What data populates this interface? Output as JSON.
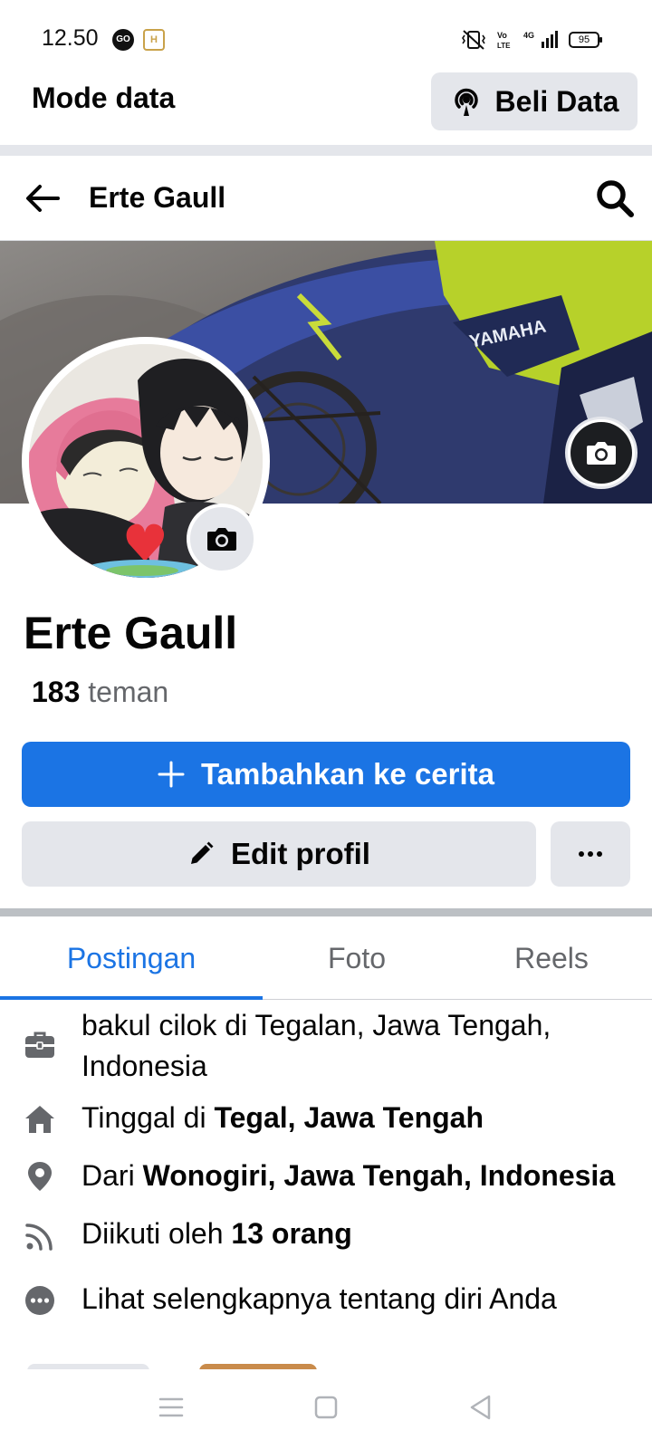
{
  "status_bar": {
    "time": "12.50",
    "battery": "95",
    "app_icon_1": "GO",
    "app_icon_2": "H"
  },
  "data_banner": {
    "mode_label": "Mode data",
    "buy_label": "Beli Data"
  },
  "header": {
    "title": "Erte Gaull"
  },
  "profile": {
    "name": "Erte Gaull",
    "friends_count": "183",
    "friends_label": "teman"
  },
  "actions": {
    "add_story": "Tambahkan ke cerita",
    "edit_profile": "Edit profil"
  },
  "tabs": [
    {
      "label": "Postingan",
      "active": true
    },
    {
      "label": "Foto",
      "active": false
    },
    {
      "label": "Reels",
      "active": false
    }
  ],
  "details": {
    "work": "bakul cilok di Tegalan, Jawa Tengah, Indonesia",
    "lives_prefix": "Tinggal di",
    "lives_place": "Tegal, Jawa Tengah",
    "from_prefix": "Dari",
    "from_place": "Wonogiri, Jawa Tengah, Indonesia",
    "followers_prefix": "Diikuti oleh",
    "followers_value": "13 orang",
    "see_more": "Lihat selengkapnya tentang diri Anda"
  },
  "cover_brand": "YAMAHA",
  "colors": {
    "accent": "#1b74e4",
    "button_gray": "#e4e6eb",
    "secondary_text": "#65676b"
  },
  "icons": {
    "back": "arrow-left-icon",
    "search": "search-icon",
    "camera": "camera-icon",
    "hotspot": "hotspot-icon",
    "plus": "plus-icon",
    "edit": "pencil-icon",
    "more": "more-dots-icon",
    "work": "briefcase-icon",
    "home": "home-icon",
    "location": "location-pin-icon",
    "followers": "rss-feed-icon",
    "see_more": "more-circle-icon"
  }
}
